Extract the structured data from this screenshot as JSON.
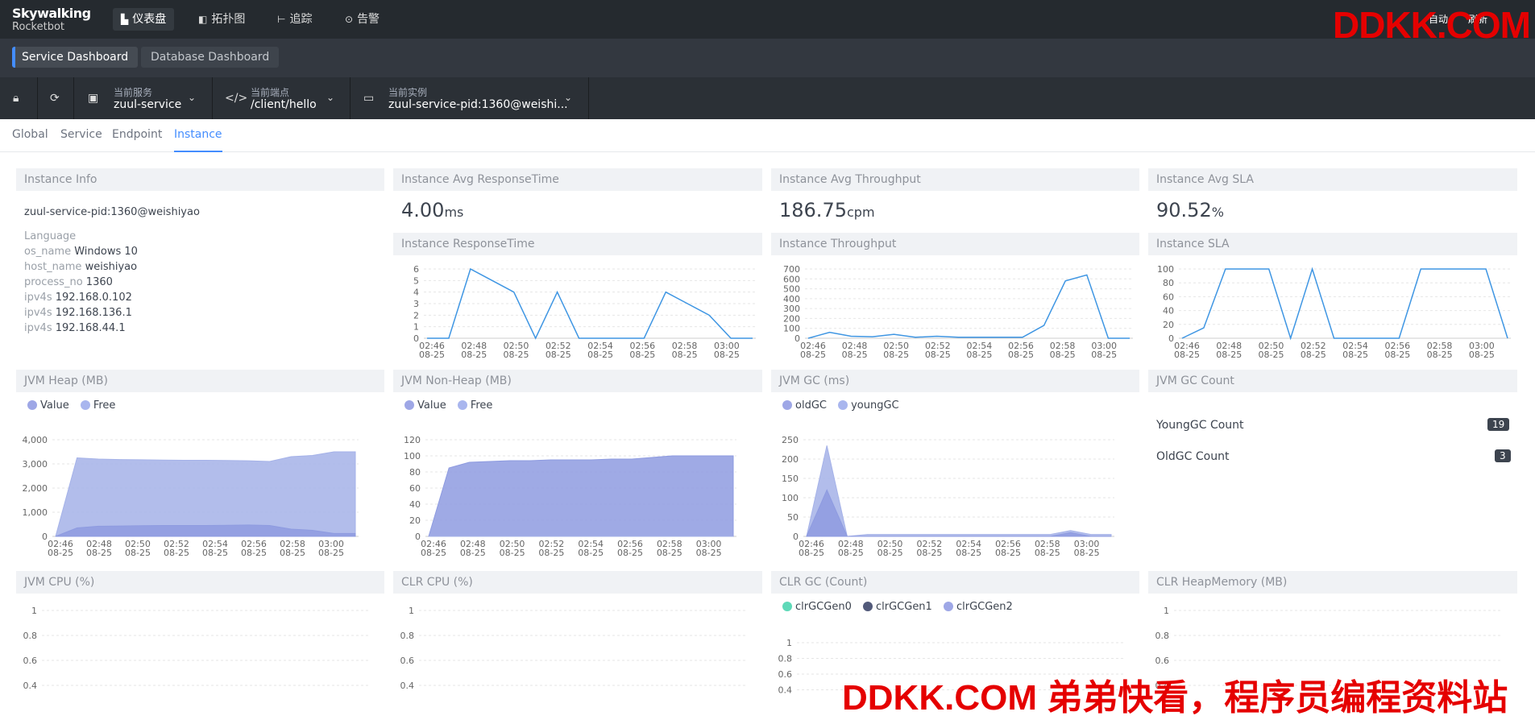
{
  "app": {
    "logo_line1": "Skywalking",
    "logo_line2": "Rocketbot"
  },
  "nav": [
    {
      "label": "仪表盘",
      "icon": "chart-icon"
    },
    {
      "label": "拓扑图",
      "icon": "topology-icon"
    },
    {
      "label": "追踪",
      "icon": "trace-icon"
    },
    {
      "label": "告警",
      "icon": "alarm-icon"
    }
  ],
  "topright": {
    "auto": "自动",
    "refresh": "刷新"
  },
  "watermark": {
    "top": "DDKK.COM",
    "bottom": "DDKK.COM 弟弟快看，程序员编程资料站"
  },
  "dashboards": [
    "Service Dashboard",
    "Database Dashboard"
  ],
  "selectors": {
    "service": {
      "label": "当前服务",
      "value": "zuul-service"
    },
    "endpoint": {
      "label": "当前端点",
      "value": "/client/hello"
    },
    "instance": {
      "label": "当前实例",
      "value": "zuul-service-pid:1360@weishi..."
    }
  },
  "subtabs": [
    "Global",
    "Service",
    "Endpoint",
    "Instance"
  ],
  "panels": {
    "instance_info": "Instance Info",
    "avg_resp": "Instance Avg ResponseTime",
    "avg_thr": "Instance Avg Throughput",
    "avg_sla": "Instance Avg SLA",
    "resp": "Instance ResponseTime",
    "thr": "Instance Throughput",
    "sla": "Instance SLA",
    "heap": "JVM Heap (MB)",
    "nonheap": "JVM Non-Heap (MB)",
    "gc": "JVM GC (ms)",
    "gccount": "JVM GC Count",
    "cpu": "JVM CPU (%)",
    "clrcpu": "CLR CPU (%)",
    "clrgc": "CLR GC (Count)",
    "clrheap": "CLR HeapMemory (MB)"
  },
  "metrics": {
    "avg_resp": {
      "value": "4.00",
      "unit": "ms"
    },
    "avg_thr": {
      "value": "186.75",
      "unit": "cpm"
    },
    "avg_sla": {
      "value": "90.52",
      "unit": "%"
    }
  },
  "instance": {
    "name": "zuul-service-pid:1360@weishiyao",
    "language_key": "Language",
    "rows": [
      {
        "k": "os_name",
        "v": "Windows 10"
      },
      {
        "k": "host_name",
        "v": "weishiyao"
      },
      {
        "k": "process_no",
        "v": "1360"
      },
      {
        "k": "ipv4s",
        "v": "192.168.0.102"
      },
      {
        "k": "ipv4s",
        "v": "192.168.136.1"
      },
      {
        "k": "ipv4s",
        "v": "192.168.44.1"
      }
    ]
  },
  "legends": {
    "heap": [
      "Value",
      "Free"
    ],
    "gc": [
      "oldGC",
      "youngGC"
    ],
    "clrgc": [
      "clrGCGen0",
      "clrGCGen1",
      "clrGCGen2"
    ]
  },
  "gc_count": {
    "young_label": "YoungGC Count",
    "young": "19",
    "old_label": "OldGC Count",
    "old": "3"
  },
  "colors": {
    "line": "#3f96e3",
    "area": "#a5b2e8",
    "area_dark": "#8e9be0",
    "green": "#5ed9b8",
    "navy": "#525a7a",
    "accent": "#448dfe"
  },
  "chart_data": [
    {
      "type": "line",
      "title": "Instance ResponseTime",
      "x": [
        "02:46\n08-25",
        "02:48\n08-25",
        "02:50\n08-25",
        "02:52\n08-25",
        "02:54\n08-25",
        "02:56\n08-25",
        "02:58\n08-25",
        "03:00\n08-25"
      ],
      "values": [
        0,
        0,
        6,
        5,
        4,
        0,
        4,
        0,
        0,
        0,
        0,
        4,
        3,
        2,
        0,
        0
      ],
      "ylim": [
        0,
        6
      ],
      "yticks": [
        0,
        1,
        2,
        3,
        4,
        5,
        6
      ]
    },
    {
      "type": "line",
      "title": "Instance Throughput",
      "values": [
        0,
        60,
        20,
        15,
        40,
        10,
        20,
        10,
        10,
        10,
        10,
        130,
        580,
        640,
        0,
        0
      ],
      "ylim": [
        0,
        700
      ],
      "yticks": [
        0,
        100,
        200,
        300,
        400,
        500,
        600,
        700
      ]
    },
    {
      "type": "line",
      "title": "Instance SLA",
      "values": [
        0,
        15,
        100,
        100,
        100,
        0,
        100,
        0,
        0,
        0,
        0,
        100,
        100,
        100,
        100,
        0
      ],
      "ylim": [
        0,
        100
      ],
      "yticks": [
        0,
        20,
        40,
        60,
        80,
        100
      ]
    },
    {
      "type": "area",
      "title": "JVM Heap (MB)",
      "series": [
        {
          "name": "Value",
          "values": [
            0,
            350,
            420,
            430,
            440,
            450,
            450,
            450,
            460,
            470,
            450,
            300,
            250,
            120,
            120
          ]
        },
        {
          "name": "Free",
          "values": [
            0,
            3250,
            3200,
            3180,
            3170,
            3160,
            3150,
            3150,
            3140,
            3130,
            3100,
            3300,
            3350,
            3500,
            3500
          ]
        }
      ],
      "ylim": [
        0,
        4000
      ],
      "yticks": [
        0,
        1000,
        2000,
        3000,
        4000
      ],
      "ytick_labels": [
        "0",
        "1,000",
        "2,000",
        "3,000",
        "4,000"
      ]
    },
    {
      "type": "area",
      "title": "JVM Non-Heap (MB)",
      "series": [
        {
          "name": "Value",
          "values": [
            0,
            85,
            92,
            93,
            94,
            94,
            95,
            95,
            95,
            96,
            96,
            98,
            100,
            100,
            100,
            100
          ]
        },
        {
          "name": "Free",
          "values": [
            0,
            0,
            0,
            0,
            0,
            0,
            0,
            0,
            0,
            0,
            0,
            0,
            0,
            0,
            0,
            0
          ]
        }
      ],
      "ylim": [
        0,
        120
      ],
      "yticks": [
        0,
        20,
        40,
        60,
        80,
        100,
        120
      ]
    },
    {
      "type": "area",
      "title": "JVM GC (ms)",
      "series": [
        {
          "name": "oldGC",
          "values": [
            0,
            120,
            0,
            0,
            0,
            0,
            0,
            0,
            0,
            0,
            0,
            0,
            0,
            10,
            0,
            0
          ]
        },
        {
          "name": "youngGC",
          "values": [
            0,
            235,
            0,
            5,
            5,
            5,
            5,
            5,
            5,
            5,
            5,
            5,
            5,
            15,
            5,
            5
          ]
        }
      ],
      "ylim": [
        0,
        250
      ],
      "yticks": [
        0,
        50,
        100,
        150,
        200,
        250
      ]
    }
  ]
}
